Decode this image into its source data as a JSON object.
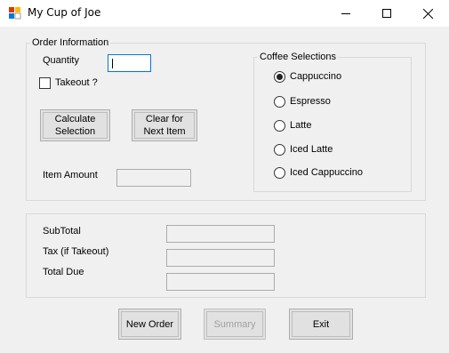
{
  "window": {
    "title": "My Cup of Joe",
    "icon": "app-icon",
    "controls": [
      "minimize-icon",
      "maximize-icon",
      "close-icon"
    ]
  },
  "order_info": {
    "legend": "Order Information",
    "quantity_label": "Quantity",
    "quantity_value": "",
    "takeout_label": "Takeout ?",
    "takeout_checked": false,
    "calculate_label": "Calculate\nSelection",
    "clear_label": "Clear for\nNext Item",
    "item_amount_label": "Item Amount",
    "item_amount_value": ""
  },
  "coffee": {
    "legend": "Coffee Selections",
    "options": [
      {
        "label": "Cappuccino",
        "checked": true
      },
      {
        "label": "Espresso",
        "checked": false
      },
      {
        "label": "Latte",
        "checked": false
      },
      {
        "label": "Iced Latte",
        "checked": false
      },
      {
        "label": "Iced Cappuccino",
        "checked": false
      }
    ]
  },
  "totals": {
    "subtotal_label": "SubTotal",
    "subtotal_value": "",
    "tax_label": "Tax (if Takeout)",
    "tax_value": "",
    "total_label": "Total Due",
    "total_value": ""
  },
  "actions": {
    "new_order": "New Order",
    "summary": "Summary",
    "summary_enabled": false,
    "exit": "Exit"
  },
  "colors": {
    "window_bg": "#f0f0f0",
    "titlebar_bg": "#ffffff",
    "focus_border": "#0078d7",
    "disabled_text": "#a0a0a0"
  }
}
